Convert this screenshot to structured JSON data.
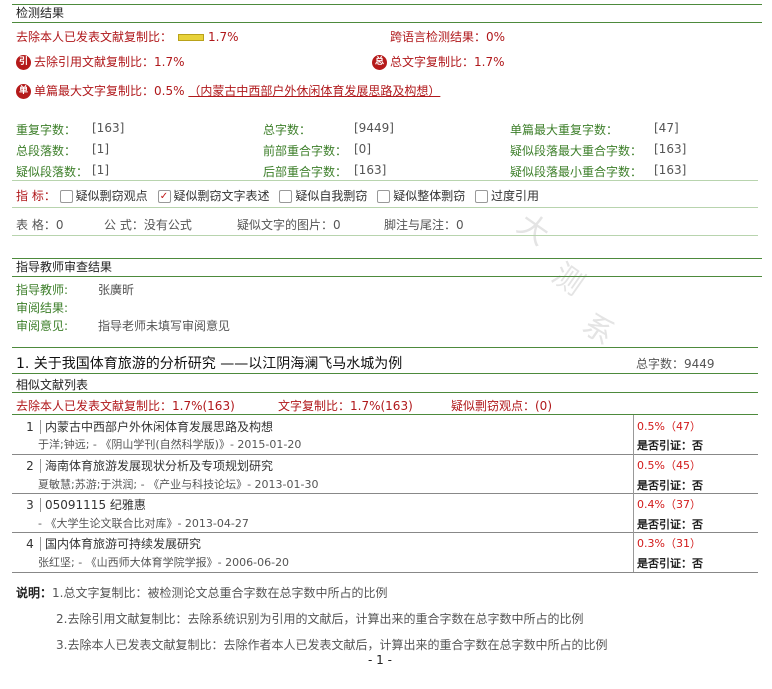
{
  "watermark": [
    "大",
    "测",
    "系"
  ],
  "result": {
    "header": "检测结果",
    "self_pub_label": "去除本人已发表文献复制比：",
    "self_pub_value": "1.7%",
    "cross_lang_label": "跨语言检测结果：",
    "cross_lang_value": "0%",
    "quote_label": "去除引用文献复制比：",
    "quote_value": "1.7%",
    "total_label": "总文字复制比：",
    "total_value": "1.7%",
    "single_label": "单篇最大文字复制比：",
    "single_value": "0.5%",
    "single_title": "（内蒙古中西部户外休闲体育发展思路及构想）",
    "badges": {
      "quote": "引",
      "total": "总",
      "single": "单"
    }
  },
  "stats": [
    {
      "label": "重复字数：",
      "value": "[163]"
    },
    {
      "label": "总字数：",
      "value": "[9449]"
    },
    {
      "label": "单篇最大重复字数：",
      "value": "[47]"
    },
    {
      "label": "总段落数：",
      "value": "[1]"
    },
    {
      "label": "前部重合字数：",
      "value": "[0]"
    },
    {
      "label": "疑似段落最大重合字数：",
      "value": "[163]"
    },
    {
      "label": "疑似段落数：",
      "value": "[1]"
    },
    {
      "label": "后部重合字数：",
      "value": "[163]"
    },
    {
      "label": "疑似段落最小重合字数：",
      "value": "[163]"
    }
  ],
  "indicators": {
    "label": "指  标：",
    "items": [
      {
        "text": "疑似剽窃观点",
        "checked": false
      },
      {
        "text": "疑似剽窃文字表述",
        "checked": true
      },
      {
        "text": "疑似自我剽窃",
        "checked": false
      },
      {
        "text": "疑似整体剽窃",
        "checked": false
      },
      {
        "text": "过度引用",
        "checked": false
      }
    ],
    "check_mark": "✓"
  },
  "misc": {
    "tables": "表  格：0",
    "formula": "公  式：没有公式",
    "images": "疑似文字的图片：0",
    "footnotes": "脚注与尾注：0"
  },
  "review": {
    "header": "指导教师审查结果",
    "teacher_label": "指导教师:",
    "teacher_value": "张廣昕",
    "status_label": "审阅结果:",
    "opinion_label": "审阅意见:",
    "opinion_value": "指导老师未填写审阅意见"
  },
  "paper": {
    "title": "1. 关于我国体育旅游的分析研究 ——以江阴海澜飞马水城为例",
    "total_chars": "总字数：9449",
    "list_header": "相似文献列表",
    "self_pub": "去除本人已发表文献复制比：1.7%(163)",
    "text_copy": "文字复制比：1.7%(163)",
    "suspect": "疑似剽窃观点：(0)",
    "rows": [
      {
        "num": "1",
        "title": "内蒙古中西部户外休闲体育发展思路及构想",
        "source": "于洋;钟远; - 《阴山学刊(自然科学版)》- 2015-01-20",
        "pct": "0.5%（47）",
        "cite": "是否引证：否"
      },
      {
        "num": "2",
        "title": "海南体育旅游发展现状分析及专项规划研究",
        "source": "夏敏慧;苏游;于洪润; - 《产业与科技论坛》- 2013-01-30",
        "pct": "0.5%（45）",
        "cite": "是否引证：否"
      },
      {
        "num": "3",
        "title": "05091115 纪雅惠",
        "source": "- 《大学生论文联合比对库》- 2013-04-27",
        "pct": "0.4%（37）",
        "cite": "是否引证：否"
      },
      {
        "num": "4",
        "title": "国内体育旅游可持续发展研究",
        "source": "张红坚; - 《山西师大体育学院学报》- 2006-06-20",
        "pct": "0.3%（31）",
        "cite": "是否引证：否"
      }
    ]
  },
  "notes": {
    "lead": "说明：",
    "items": [
      "1.总文字复制比：被检测论文总重合字数在总字数中所占的比例",
      "2.去除引用文献复制比：去除系统识别为引用的文献后，计算出来的重合字数在总字数中所占的比例",
      "3.去除本人已发表文献复制比：去除作者本人已发表文献后，计算出来的重合字数在总字数中所占的比例"
    ]
  },
  "page_number": "- 1 -"
}
